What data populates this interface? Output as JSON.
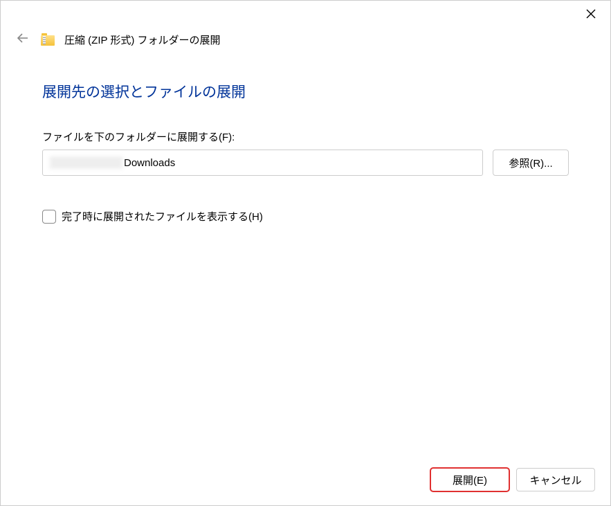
{
  "titlebar": {
    "close_label": "Close"
  },
  "header": {
    "wizard_title": "圧縮 (ZIP 形式) フォルダーの展開"
  },
  "content": {
    "heading": "展開先の選択とファイルの展開",
    "path_label": "ファイルを下のフォルダーに展開する(F):",
    "path_value_visible": "Downloads",
    "browse_label": "参照(R)...",
    "checkbox_label": "完了時に展開されたファイルを表示する(H)",
    "checkbox_checked": false
  },
  "footer": {
    "extract_label": "展開(E)",
    "cancel_label": "キャンセル"
  }
}
